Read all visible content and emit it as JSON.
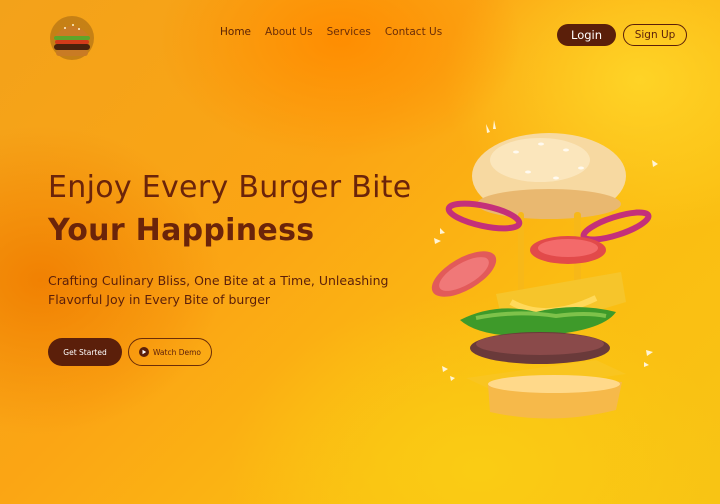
{
  "logo": {
    "alt": "burger logo"
  },
  "nav": {
    "items": [
      {
        "label": "Home",
        "active": true
      },
      {
        "label": "About Us"
      },
      {
        "label": "Services"
      },
      {
        "label": "Contact Us"
      }
    ]
  },
  "auth": {
    "login_label": "Login",
    "signup_label": "Sign Up"
  },
  "hero": {
    "title_line1": "Enjoy Every Burger Bite",
    "title_line2": "Your Happiness",
    "subtitle": "Crafting Culinary Bliss, One Bite at a Time, Unleashing Flavorful Joy in Every Bite of burger",
    "get_started_label": "Get Started",
    "watch_demo_label": "Watch Demo"
  },
  "colors": {
    "brand_dark": "#5b1f0a",
    "background_orange": "#f9a11a",
    "background_yellow": "#fbc214"
  },
  "icons": {
    "play": "play-icon"
  }
}
